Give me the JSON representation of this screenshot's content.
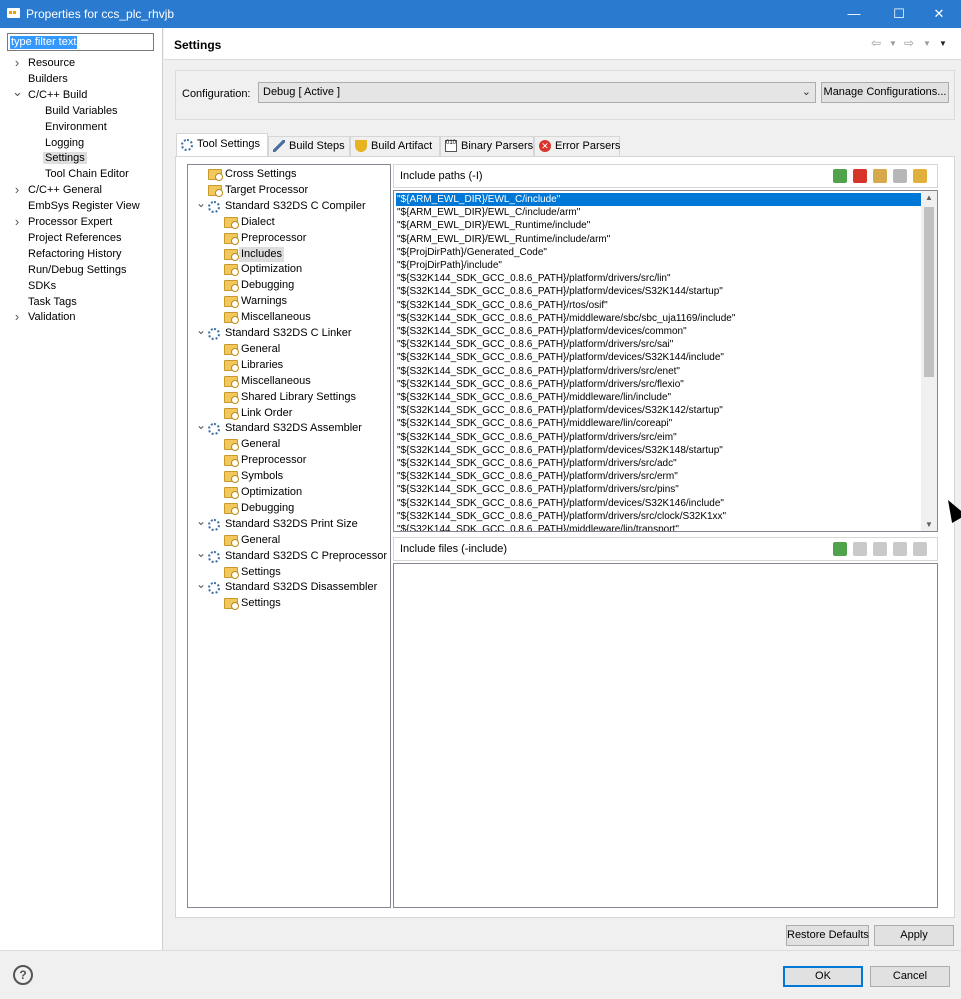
{
  "window": {
    "title": "Properties for ccs_plc_rhvjb",
    "minimize": "—",
    "maximize": "☐",
    "close": "✕"
  },
  "filter": {
    "placeholder": "type filter text"
  },
  "left_nav": [
    {
      "label": "Resource",
      "expander": ">"
    },
    {
      "label": "Builders"
    },
    {
      "label": "C/C++ Build",
      "expander": "v"
    },
    {
      "label": "Build Variables"
    },
    {
      "label": "Environment"
    },
    {
      "label": "Logging"
    },
    {
      "label": "Settings"
    },
    {
      "label": "Tool Chain Editor"
    },
    {
      "label": "C/C++ General",
      "expander": ">"
    },
    {
      "label": "EmbSys Register View"
    },
    {
      "label": "Processor Expert",
      "expander": ">"
    },
    {
      "label": "Project References"
    },
    {
      "label": "Refactoring History"
    },
    {
      "label": "Run/Debug Settings"
    },
    {
      "label": "SDKs"
    },
    {
      "label": "Task Tags"
    },
    {
      "label": "Validation",
      "expander": ">"
    }
  ],
  "header": {
    "title": "Settings"
  },
  "configuration": {
    "label": "Configuration:",
    "value": "Debug  [ Active ]",
    "manage_button": "Manage Configurations..."
  },
  "tabs": [
    {
      "label": "Tool Settings",
      "icon": "gear-icon"
    },
    {
      "label": "Build Steps",
      "icon": "wrench-icon"
    },
    {
      "label": "Build Artifact",
      "icon": "trophy-icon"
    },
    {
      "label": "Binary Parsers",
      "icon": "binary-icon"
    },
    {
      "label": "Error Parsers",
      "icon": "error-icon"
    }
  ],
  "tree": [
    {
      "label": "Cross Settings"
    },
    {
      "label": "Target Processor"
    },
    {
      "label": "Standard S32DS C Compiler"
    },
    {
      "label": "Dialect"
    },
    {
      "label": "Preprocessor"
    },
    {
      "label": "Includes"
    },
    {
      "label": "Optimization"
    },
    {
      "label": "Debugging"
    },
    {
      "label": "Warnings"
    },
    {
      "label": "Miscellaneous"
    },
    {
      "label": "Standard S32DS C Linker"
    },
    {
      "label": "General"
    },
    {
      "label": "Libraries"
    },
    {
      "label": "Miscellaneous"
    },
    {
      "label": "Shared Library Settings"
    },
    {
      "label": "Link Order"
    },
    {
      "label": "Standard S32DS Assembler"
    },
    {
      "label": "General"
    },
    {
      "label": "Preprocessor"
    },
    {
      "label": "Symbols"
    },
    {
      "label": "Optimization"
    },
    {
      "label": "Debugging"
    },
    {
      "label": "Standard S32DS Print Size"
    },
    {
      "label": "General"
    },
    {
      "label": "Standard S32DS C Preprocessor"
    },
    {
      "label": "Settings"
    },
    {
      "label": "Standard S32DS Disassembler"
    },
    {
      "label": "Settings"
    }
  ],
  "include_paths": {
    "caption": "Include paths (-I)",
    "items": [
      "\"${ARM_EWL_DIR}/EWL_C/include\"",
      "\"${ARM_EWL_DIR}/EWL_C/include/arm\"",
      "\"${ARM_EWL_DIR}/EWL_Runtime/include\"",
      "\"${ARM_EWL_DIR}/EWL_Runtime/include/arm\"",
      "\"${ProjDirPath}/Generated_Code\"",
      "\"${ProjDirPath}/include\"",
      "\"${S32K144_SDK_GCC_0.8.6_PATH}/platform/drivers/src/lin\"",
      "\"${S32K144_SDK_GCC_0.8.6_PATH}/platform/devices/S32K144/startup\"",
      "\"${S32K144_SDK_GCC_0.8.6_PATH}/rtos/osif\"",
      "\"${S32K144_SDK_GCC_0.8.6_PATH}/middleware/sbc/sbc_uja1169/include\"",
      "\"${S32K144_SDK_GCC_0.8.6_PATH}/platform/devices/common\"",
      "\"${S32K144_SDK_GCC_0.8.6_PATH}/platform/drivers/src/sai\"",
      "\"${S32K144_SDK_GCC_0.8.6_PATH}/platform/devices/S32K144/include\"",
      "\"${S32K144_SDK_GCC_0.8.6_PATH}/platform/drivers/src/enet\"",
      "\"${S32K144_SDK_GCC_0.8.6_PATH}/platform/drivers/src/flexio\"",
      "\"${S32K144_SDK_GCC_0.8.6_PATH}/middleware/lin/include\"",
      "\"${S32K144_SDK_GCC_0.8.6_PATH}/platform/devices/S32K142/startup\"",
      "\"${S32K144_SDK_GCC_0.8.6_PATH}/middleware/lin/coreapi\"",
      "\"${S32K144_SDK_GCC_0.8.6_PATH}/platform/drivers/src/eim\"",
      "\"${S32K144_SDK_GCC_0.8.6_PATH}/platform/devices/S32K148/startup\"",
      "\"${S32K144_SDK_GCC_0.8.6_PATH}/platform/drivers/src/adc\"",
      "\"${S32K144_SDK_GCC_0.8.6_PATH}/platform/drivers/src/erm\"",
      "\"${S32K144_SDK_GCC_0.8.6_PATH}/platform/drivers/src/pins\"",
      "\"${S32K144_SDK_GCC_0.8.6_PATH}/platform/devices/S32K146/include\"",
      "\"${S32K144_SDK_GCC_0.8.6_PATH}/platform/drivers/src/clock/S32K1xx\"",
      "\"${S32K144_SDK_GCC_0.8.6_PATH}/middleware/lin/transport\""
    ]
  },
  "include_files": {
    "caption": "Include files (-include)"
  },
  "buttons": {
    "restore_defaults": "Restore Defaults",
    "apply": "Apply",
    "ok": "OK",
    "cancel": "Cancel"
  },
  "help": {
    "glyph": "?"
  }
}
